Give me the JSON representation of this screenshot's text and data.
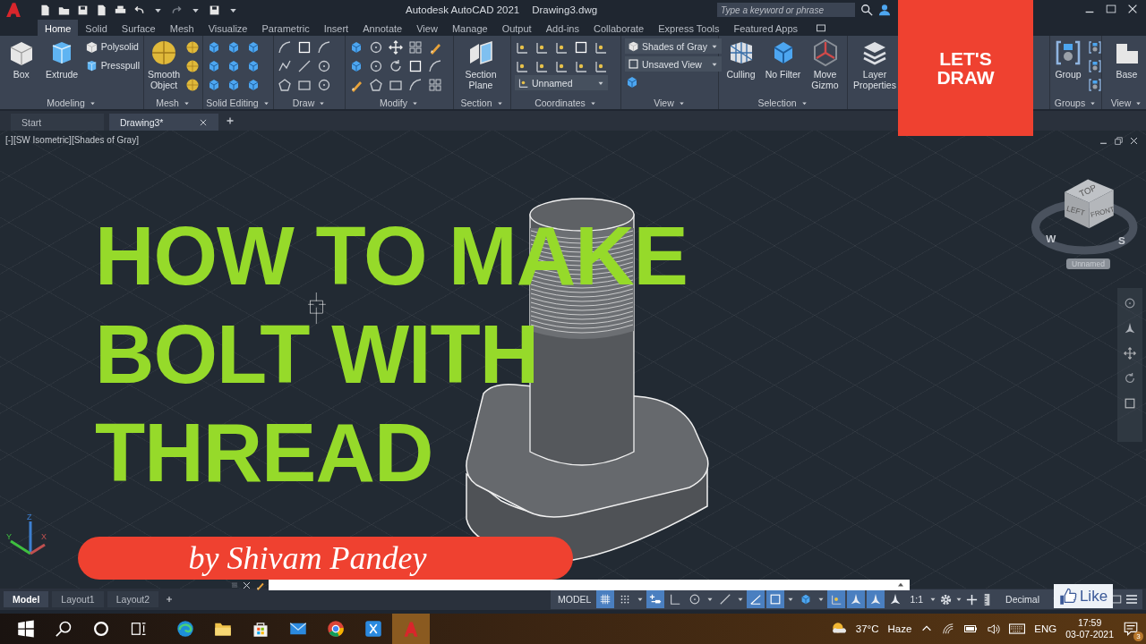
{
  "title_bar": {
    "app_title": "Autodesk AutoCAD 2021",
    "file_name": "Drawing3.dwg",
    "search": {
      "placeholder": "Type a keyword or phrase"
    }
  },
  "ribbon_tabs": [
    {
      "label": "Home",
      "selected": true
    },
    {
      "label": "Solid",
      "selected": false
    },
    {
      "label": "Surface",
      "selected": false
    },
    {
      "label": "Mesh",
      "selected": false
    },
    {
      "label": "Visualize",
      "selected": false
    },
    {
      "label": "Parametric",
      "selected": false
    },
    {
      "label": "Insert",
      "selected": false
    },
    {
      "label": "Annotate",
      "selected": false
    },
    {
      "label": "View",
      "selected": false
    },
    {
      "label": "Manage",
      "selected": false
    },
    {
      "label": "Output",
      "selected": false
    },
    {
      "label": "Add-ins",
      "selected": false
    },
    {
      "label": "Collaborate",
      "selected": false
    },
    {
      "label": "Express Tools",
      "selected": false
    },
    {
      "label": "Featured Apps",
      "selected": false
    }
  ],
  "ribbon_panels": [
    {
      "label": "Modeling",
      "items": [
        {
          "kind": "large",
          "label": "Box"
        },
        {
          "kind": "large",
          "label": "Extrude"
        },
        {
          "kind": "small",
          "label": "Polysolid"
        },
        {
          "kind": "small",
          "label": "Presspull"
        }
      ]
    },
    {
      "label": "Mesh",
      "items": [
        {
          "kind": "large",
          "label": "Smooth Object"
        }
      ]
    },
    {
      "label": "Solid Editing"
    },
    {
      "label": "Draw"
    },
    {
      "label": "Modify"
    },
    {
      "label": "Section",
      "items": [
        {
          "kind": "large",
          "label": "Section Plane"
        }
      ]
    },
    {
      "label": "Coordinates",
      "items": [
        {
          "kind": "dropdown",
          "label": "Unnamed"
        }
      ]
    },
    {
      "label": "View",
      "items": [
        {
          "kind": "dropdown",
          "label": "Shades of Gray"
        },
        {
          "kind": "dropdown",
          "label": "Unsaved View"
        }
      ]
    },
    {
      "label": "Selection",
      "items": [
        {
          "kind": "large",
          "label": "Culling"
        },
        {
          "kind": "large",
          "label": "No Filter"
        },
        {
          "kind": "large",
          "label": "Move Gizmo"
        }
      ]
    },
    {
      "items": [
        {
          "kind": "large",
          "label": "Layer Properties"
        }
      ]
    },
    {
      "label": "Groups",
      "items": [
        {
          "kind": "large",
          "label": "Group"
        }
      ]
    },
    {
      "label": "View",
      "items": [
        {
          "kind": "large",
          "label": "Base"
        }
      ]
    }
  ],
  "file_tabs": [
    {
      "label": "Start",
      "selected": false
    },
    {
      "label": "Drawing3*",
      "selected": true
    }
  ],
  "viewport": {
    "label": "[-][SW Isometric][Shades of Gray]",
    "view_cube": {
      "faces": [
        "TOP",
        "LEFT",
        "FRONT"
      ],
      "compass": [
        "W",
        "S"
      ],
      "view_menu": "Unnamed"
    },
    "ucs_axes": [
      "X",
      "Y",
      "Z"
    ]
  },
  "headline": [
    "HOW TO MAKE",
    "BOLT WITH",
    "THREAD"
  ],
  "badge": "LET'S DRAW",
  "byline": "by Shivam Pandey",
  "layout_tabs": [
    {
      "label": "Model",
      "selected": true
    },
    {
      "label": "Layout1",
      "selected": false
    },
    {
      "label": "Layout2",
      "selected": false
    }
  ],
  "status_bar": {
    "space": "MODEL",
    "toggles": [
      {
        "on": true
      },
      {
        "on": false
      },
      {
        "on": true
      },
      {
        "on": false
      },
      {
        "on": false
      },
      {
        "on": false
      },
      {
        "on": true
      },
      {
        "on": true
      },
      {
        "on": false
      },
      {
        "on": true
      },
      {
        "on": true
      },
      {
        "on": true
      },
      {
        "on": false
      }
    ],
    "annotation_scale": "1:1",
    "units": "Decimal"
  },
  "like_button": {
    "label": "Like"
  },
  "taskbar": {
    "apps": [
      {
        "selected": false
      },
      {
        "selected": false
      },
      {
        "selected": false
      },
      {
        "selected": false
      },
      {
        "selected": false
      },
      {
        "selected": false
      },
      {
        "selected": false
      },
      {
        "selected": false
      },
      {
        "selected": false
      },
      {
        "selected": false
      },
      {
        "selected": true
      }
    ],
    "weather": {
      "temperature": "37°C",
      "condition": "Haze"
    },
    "language": "ENG",
    "time": "17:59",
    "date": "03-07-2021",
    "notifications": "3"
  }
}
